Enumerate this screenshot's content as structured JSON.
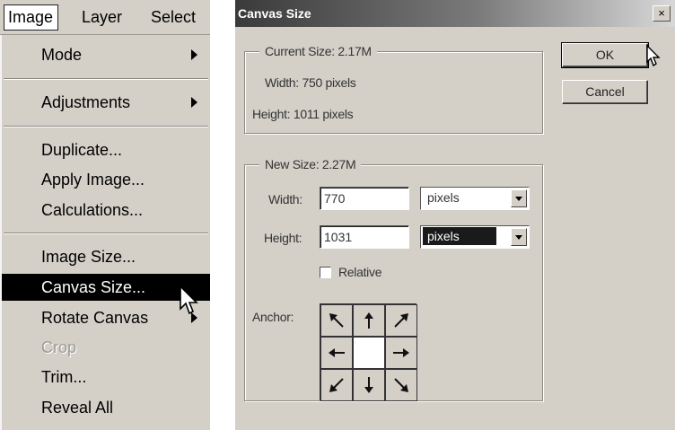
{
  "menubar": {
    "image": "Image",
    "layer": "Layer",
    "select": "Select"
  },
  "image_menu": {
    "items": [
      {
        "label": "Mode",
        "submenu": true
      },
      {
        "label": "Adjustments",
        "submenu": true
      },
      {
        "label": "Duplicate..."
      },
      {
        "label": "Apply Image..."
      },
      {
        "label": "Calculations..."
      },
      {
        "label": "Image Size..."
      },
      {
        "label": "Canvas Size...",
        "highlighted": true
      },
      {
        "label": "Rotate Canvas",
        "submenu": true
      },
      {
        "label": "Crop",
        "disabled": true
      },
      {
        "label": "Trim..."
      },
      {
        "label": "Reveal All"
      }
    ]
  },
  "dialog": {
    "title": "Canvas Size",
    "close_glyph": "×",
    "current": {
      "legend": "Current Size: 2.17M",
      "width": "Width: 750 pixels",
      "height": "Height: 1011 pixels"
    },
    "new": {
      "legend": "New Size: 2.27M",
      "width_label": "Width:",
      "width_value": "770",
      "width_unit": "pixels",
      "height_label": "Height:",
      "height_value": "1031",
      "height_unit": "pixels",
      "relative_label": "Relative",
      "relative_checked": false,
      "anchor_label": "Anchor:",
      "anchor_selected": "center"
    },
    "ok": "OK",
    "cancel": "Cancel"
  },
  "icons": {
    "submenu": "submenu-arrow-icon",
    "cursor": "mouse-pointer-icon",
    "dropdown": "dropdown-arrow-icon",
    "anchor": [
      "arrow-nw-icon",
      "arrow-n-icon",
      "arrow-ne-icon",
      "arrow-w-icon",
      "",
      "arrow-e-icon",
      "arrow-sw-icon",
      "arrow-s-icon",
      "arrow-se-icon"
    ]
  },
  "colors": {
    "ui_face": "#d4d0c8",
    "highlight": "#000000"
  }
}
